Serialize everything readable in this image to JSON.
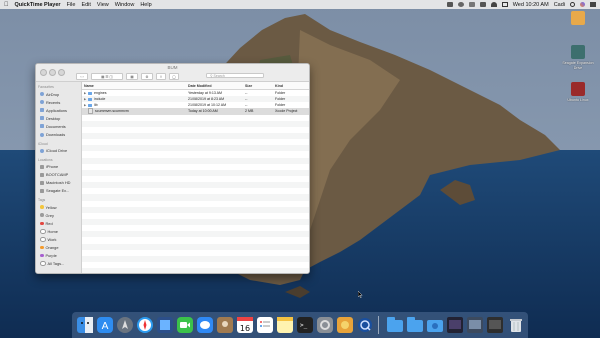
{
  "menubar": {
    "app_name": "QuickTime Player",
    "menus": [
      "File",
      "Edit",
      "View",
      "Window",
      "Help"
    ],
    "clock": "Wed 10:20 AM",
    "user": "Cadi"
  },
  "desktop_icons": [
    {
      "label": ""
    },
    {
      "label": "Seagate Expansion Drive"
    },
    {
      "label": "Ubuntu Linux"
    }
  ],
  "finder": {
    "title": "BUM",
    "search_placeholder": "Search",
    "sidebar": {
      "favorites_header": "Favourites",
      "favorites": [
        "AirDrop",
        "Recents",
        "Applications",
        "Desktop",
        "Documents",
        "Downloads"
      ],
      "icloud_header": "iCloud",
      "icloud": [
        "iCloud Drive"
      ],
      "locations_header": "Locations",
      "locations": [
        "iPhone",
        "BOOTCAMP",
        "Macintosh HD",
        "Seagate Ex..."
      ],
      "tags_header": "Tags",
      "tags": [
        {
          "label": "Yellow",
          "color": "#f2c53d"
        },
        {
          "label": "Grey",
          "color": "#9b9b9b"
        },
        {
          "label": "Red",
          "color": "#e2463f"
        },
        {
          "label": "Home",
          "color": "#ffffff"
        },
        {
          "label": "Work",
          "color": "#ffffff"
        },
        {
          "label": "Orange",
          "color": "#f39a2c"
        },
        {
          "label": "Purple",
          "color": "#a65fcf"
        },
        {
          "label": "All Tags...",
          "color": "#ffffff"
        }
      ]
    },
    "columns": {
      "name": "Name",
      "date": "Date Modified",
      "size": "Size",
      "kind": "Kind"
    },
    "files": [
      {
        "name": "engines",
        "date": "Yesterday at 9:13 AM",
        "size": "--",
        "kind": "Folder",
        "type": "folder"
      },
      {
        "name": "include",
        "date": "21/08/2019 at 8:23 AM",
        "size": "--",
        "kind": "Folder",
        "type": "folder"
      },
      {
        "name": "lib",
        "date": "21/08/2019 at 10:12 AM",
        "size": "--",
        "kind": "Folder",
        "type": "folder"
      },
      {
        "name": "scummvm.scummvm",
        "date": "Today at 10:00 AM",
        "size": "2 MB",
        "kind": "Xcode Project",
        "type": "file"
      }
    ]
  },
  "colors": {
    "selected_row": "#dcdcdc",
    "folder": "#6aa6e8",
    "sidebar": "#e8e8e8"
  }
}
